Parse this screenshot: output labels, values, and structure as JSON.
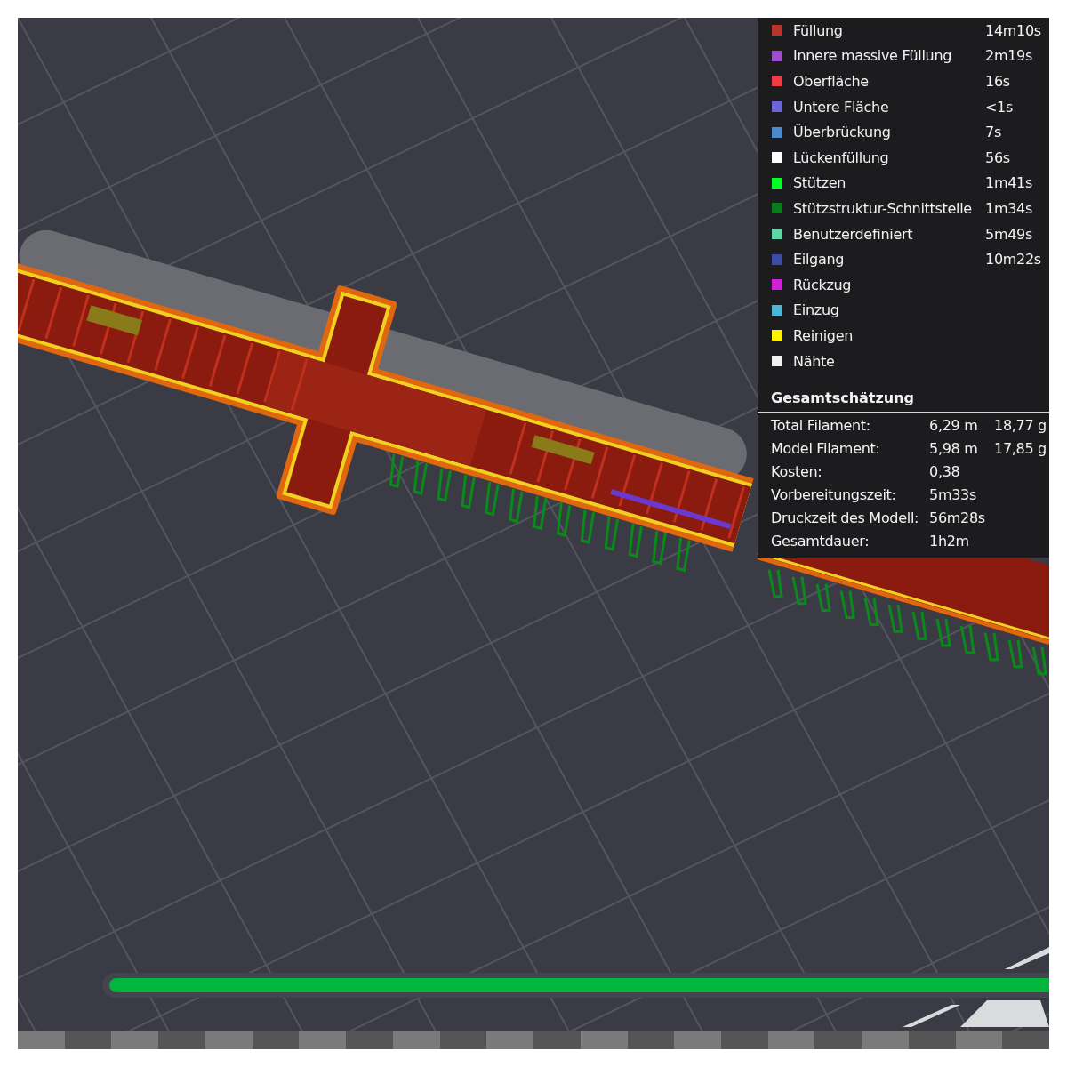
{
  "legend": {
    "rows": [
      {
        "label": "Füllung",
        "time": "14m10s",
        "color": "#b8332c"
      },
      {
        "label": "Innere massive Füllung",
        "time": "2m19s",
        "color": "#9a4fcf"
      },
      {
        "label": "Oberfläche",
        "time": "16s",
        "color": "#f03b46"
      },
      {
        "label": "Untere Fläche",
        "time": "<1s",
        "color": "#6b63d6"
      },
      {
        "label": "Überbrückung",
        "time": "7s",
        "color": "#4a8ad0"
      },
      {
        "label": "Lückenfüllung",
        "time": "56s",
        "color": "#ffffff"
      },
      {
        "label": "Stützen",
        "time": "1m41s",
        "color": "#00ff22"
      },
      {
        "label": "Stützstruktur-Schnittstelle",
        "time": "1m34s",
        "color": "#0a7a1a"
      },
      {
        "label": "Benutzerdefiniert",
        "time": "5m49s",
        "color": "#5fd6a3"
      },
      {
        "label": "Eilgang",
        "time": "10m22s",
        "color": "#3c4aa8"
      },
      {
        "label": "Rückzug",
        "color": "#d21fd8"
      },
      {
        "label": "Einzug",
        "color": "#4db6d6"
      },
      {
        "label": "Reinigen",
        "color": "#ffef00"
      },
      {
        "label": "Nähte",
        "color": "#f0f0f0"
      }
    ]
  },
  "estimate": {
    "title": "Gesamtschätzung",
    "rows": [
      {
        "label": "Total Filament:",
        "values": [
          "6,29 m",
          "18,77 g"
        ]
      },
      {
        "label": "Model Filament:",
        "values": [
          "5,98 m",
          "17,85 g"
        ]
      },
      {
        "label": "Kosten:",
        "values": [
          "0,38"
        ]
      },
      {
        "label": "Vorbereitungszeit:",
        "values": [
          "5m33s"
        ]
      },
      {
        "label": "Druckzeit des Modell:",
        "values": [
          "56m28s"
        ]
      },
      {
        "label": "Gesamtdauer:",
        "values": [
          "1h2m"
        ]
      }
    ]
  },
  "layer_slider": {
    "level": 1
  }
}
